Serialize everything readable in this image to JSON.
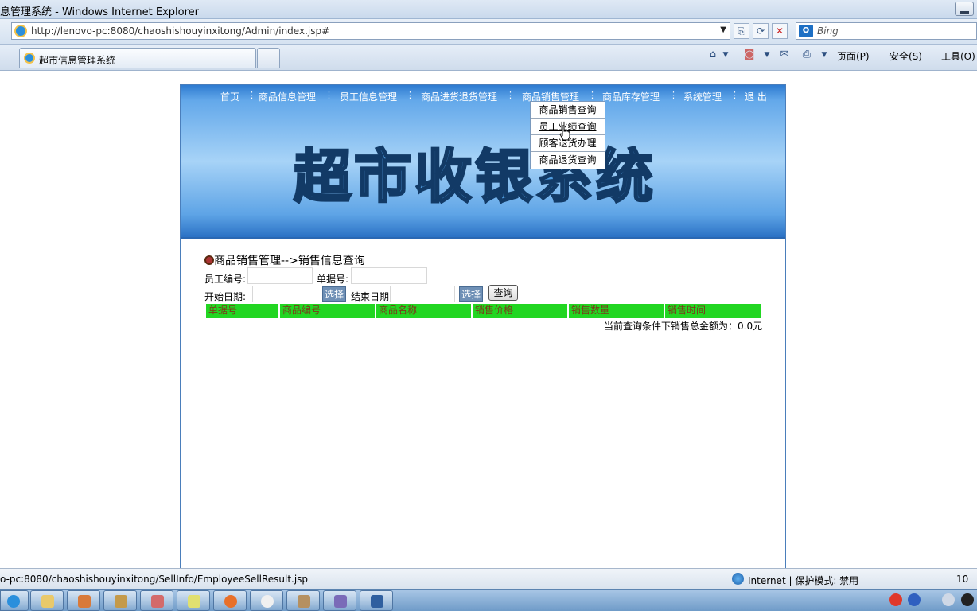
{
  "window": {
    "title": "超市信息管理系统 - Windows Internet Explorer",
    "title_visible": "息管理系统 - Windows Internet Explorer"
  },
  "address": {
    "url": "http://lenovo-pc:8080/chaoshishouyinxitong/Admin/index.jsp#",
    "search_engine": "Bing"
  },
  "tab": {
    "title": "超市信息管理系统"
  },
  "commands": {
    "page": "页面(P)",
    "safety": "安全(S)",
    "tools": "工具(O)"
  },
  "nav": {
    "items": [
      "首页",
      "商品信息管理",
      "员工信息管理",
      "商品进货退货管理",
      "商品销售管理",
      "商品库存管理",
      "系统管理",
      "退 出"
    ],
    "dropdown": [
      "商品销售查询",
      "员工业绩查询",
      "顾客退货办理",
      "商品退货查询"
    ]
  },
  "banner": {
    "text": "超市收银系统"
  },
  "form": {
    "breadcrumb": "商品销售管理-->销售信息查询",
    "employee_no_label": "员工编号:",
    "bill_no_label": "单据号:",
    "start_date_label": "开始日期:",
    "end_date_label": "结束日期",
    "select_label": "选择",
    "query_label": "查询"
  },
  "table": {
    "headers": [
      "单据号",
      "商品编号",
      "商品名称",
      "销售价格",
      "销售数量",
      "销售时间"
    ]
  },
  "total": "当前查询条件下销售总金额为：0.0元",
  "status": {
    "url": "o-pc:8080/chaoshishouyinxitong/SellInfo/EmployeeSellResult.jsp",
    "zone": "Internet | 保护模式: 禁用",
    "zoom": "10"
  },
  "colors": {
    "banner": "#5ea4e6",
    "header": "#22d622",
    "header_text": "#7a3a1a",
    "select_button": "#6f90b6"
  }
}
